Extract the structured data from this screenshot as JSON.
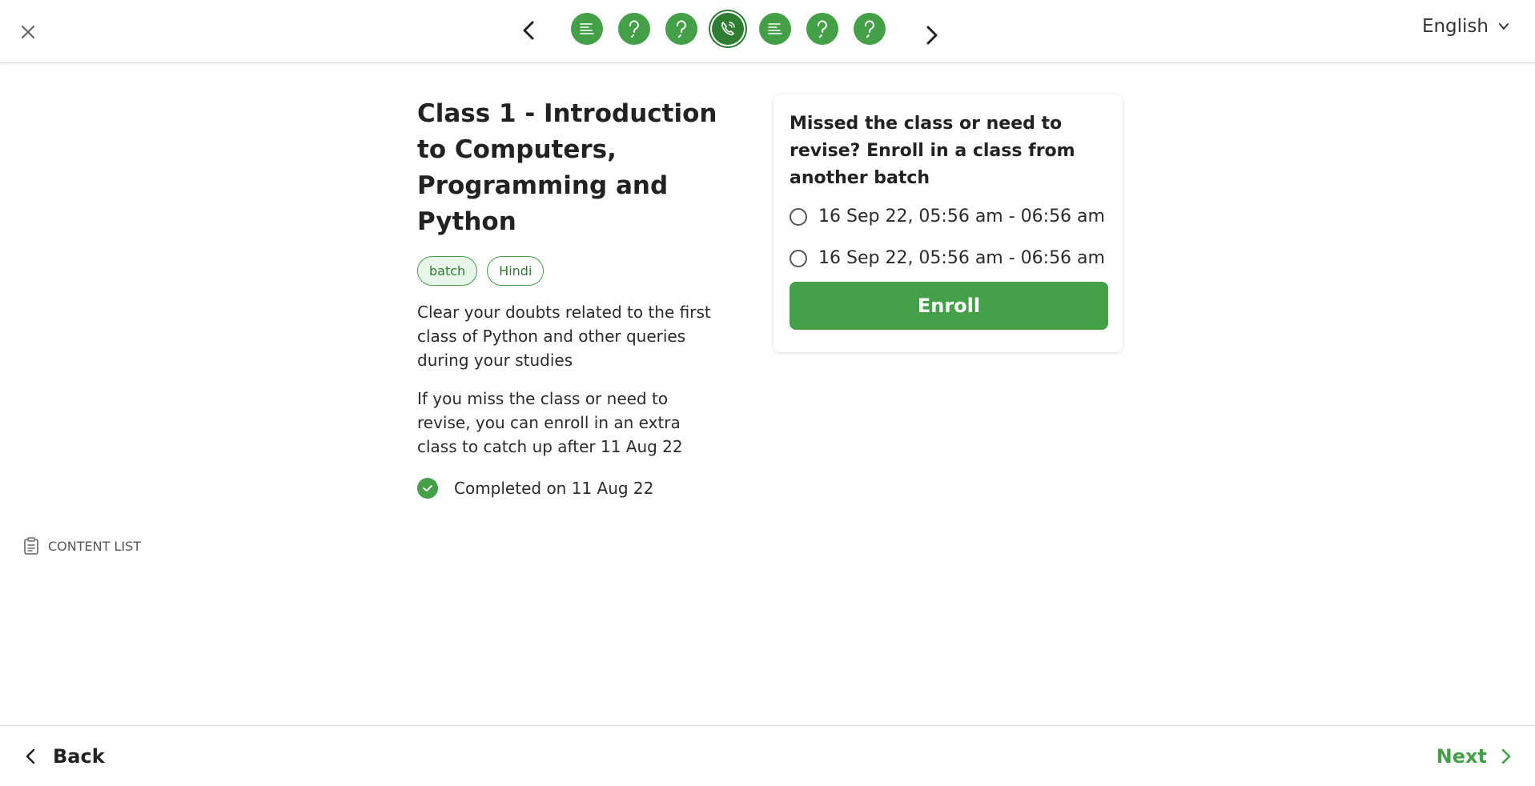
{
  "header": {
    "language": "English",
    "steps": [
      {
        "icon": "lines-icon"
      },
      {
        "icon": "question-icon"
      },
      {
        "icon": "question-icon"
      },
      {
        "icon": "phone-icon",
        "active": true
      },
      {
        "icon": "lines-icon"
      },
      {
        "icon": "question-icon"
      },
      {
        "icon": "question-icon"
      }
    ]
  },
  "class": {
    "title": "Class 1 - Introduction to Computers, Programming and Python",
    "tags": [
      "batch",
      "Hindi"
    ],
    "description": "Clear your doubts related to the first class of Python and other queries during your studies",
    "extra_info": "If you miss the class or need to revise, you can enroll in an extra class to catch up after 11 Aug 22",
    "status": "Completed on 11 Aug 22"
  },
  "enroll_card": {
    "question": "Missed the class or need to revise? Enroll in a class from another batch",
    "options": [
      "16 Sep 22, 05:56 am - 06:56 am",
      "16 Sep 22, 05:56 am - 06:56 am"
    ],
    "button_label": "Enroll"
  },
  "sidebar": {
    "content_list_label": "CONTENT LIST"
  },
  "footer": {
    "back_label": "Back",
    "next_label": "Next"
  },
  "colors": {
    "accent": "#43a047",
    "accent_dark": "#2e7d32",
    "tag_fill": "#e8f5e9"
  }
}
